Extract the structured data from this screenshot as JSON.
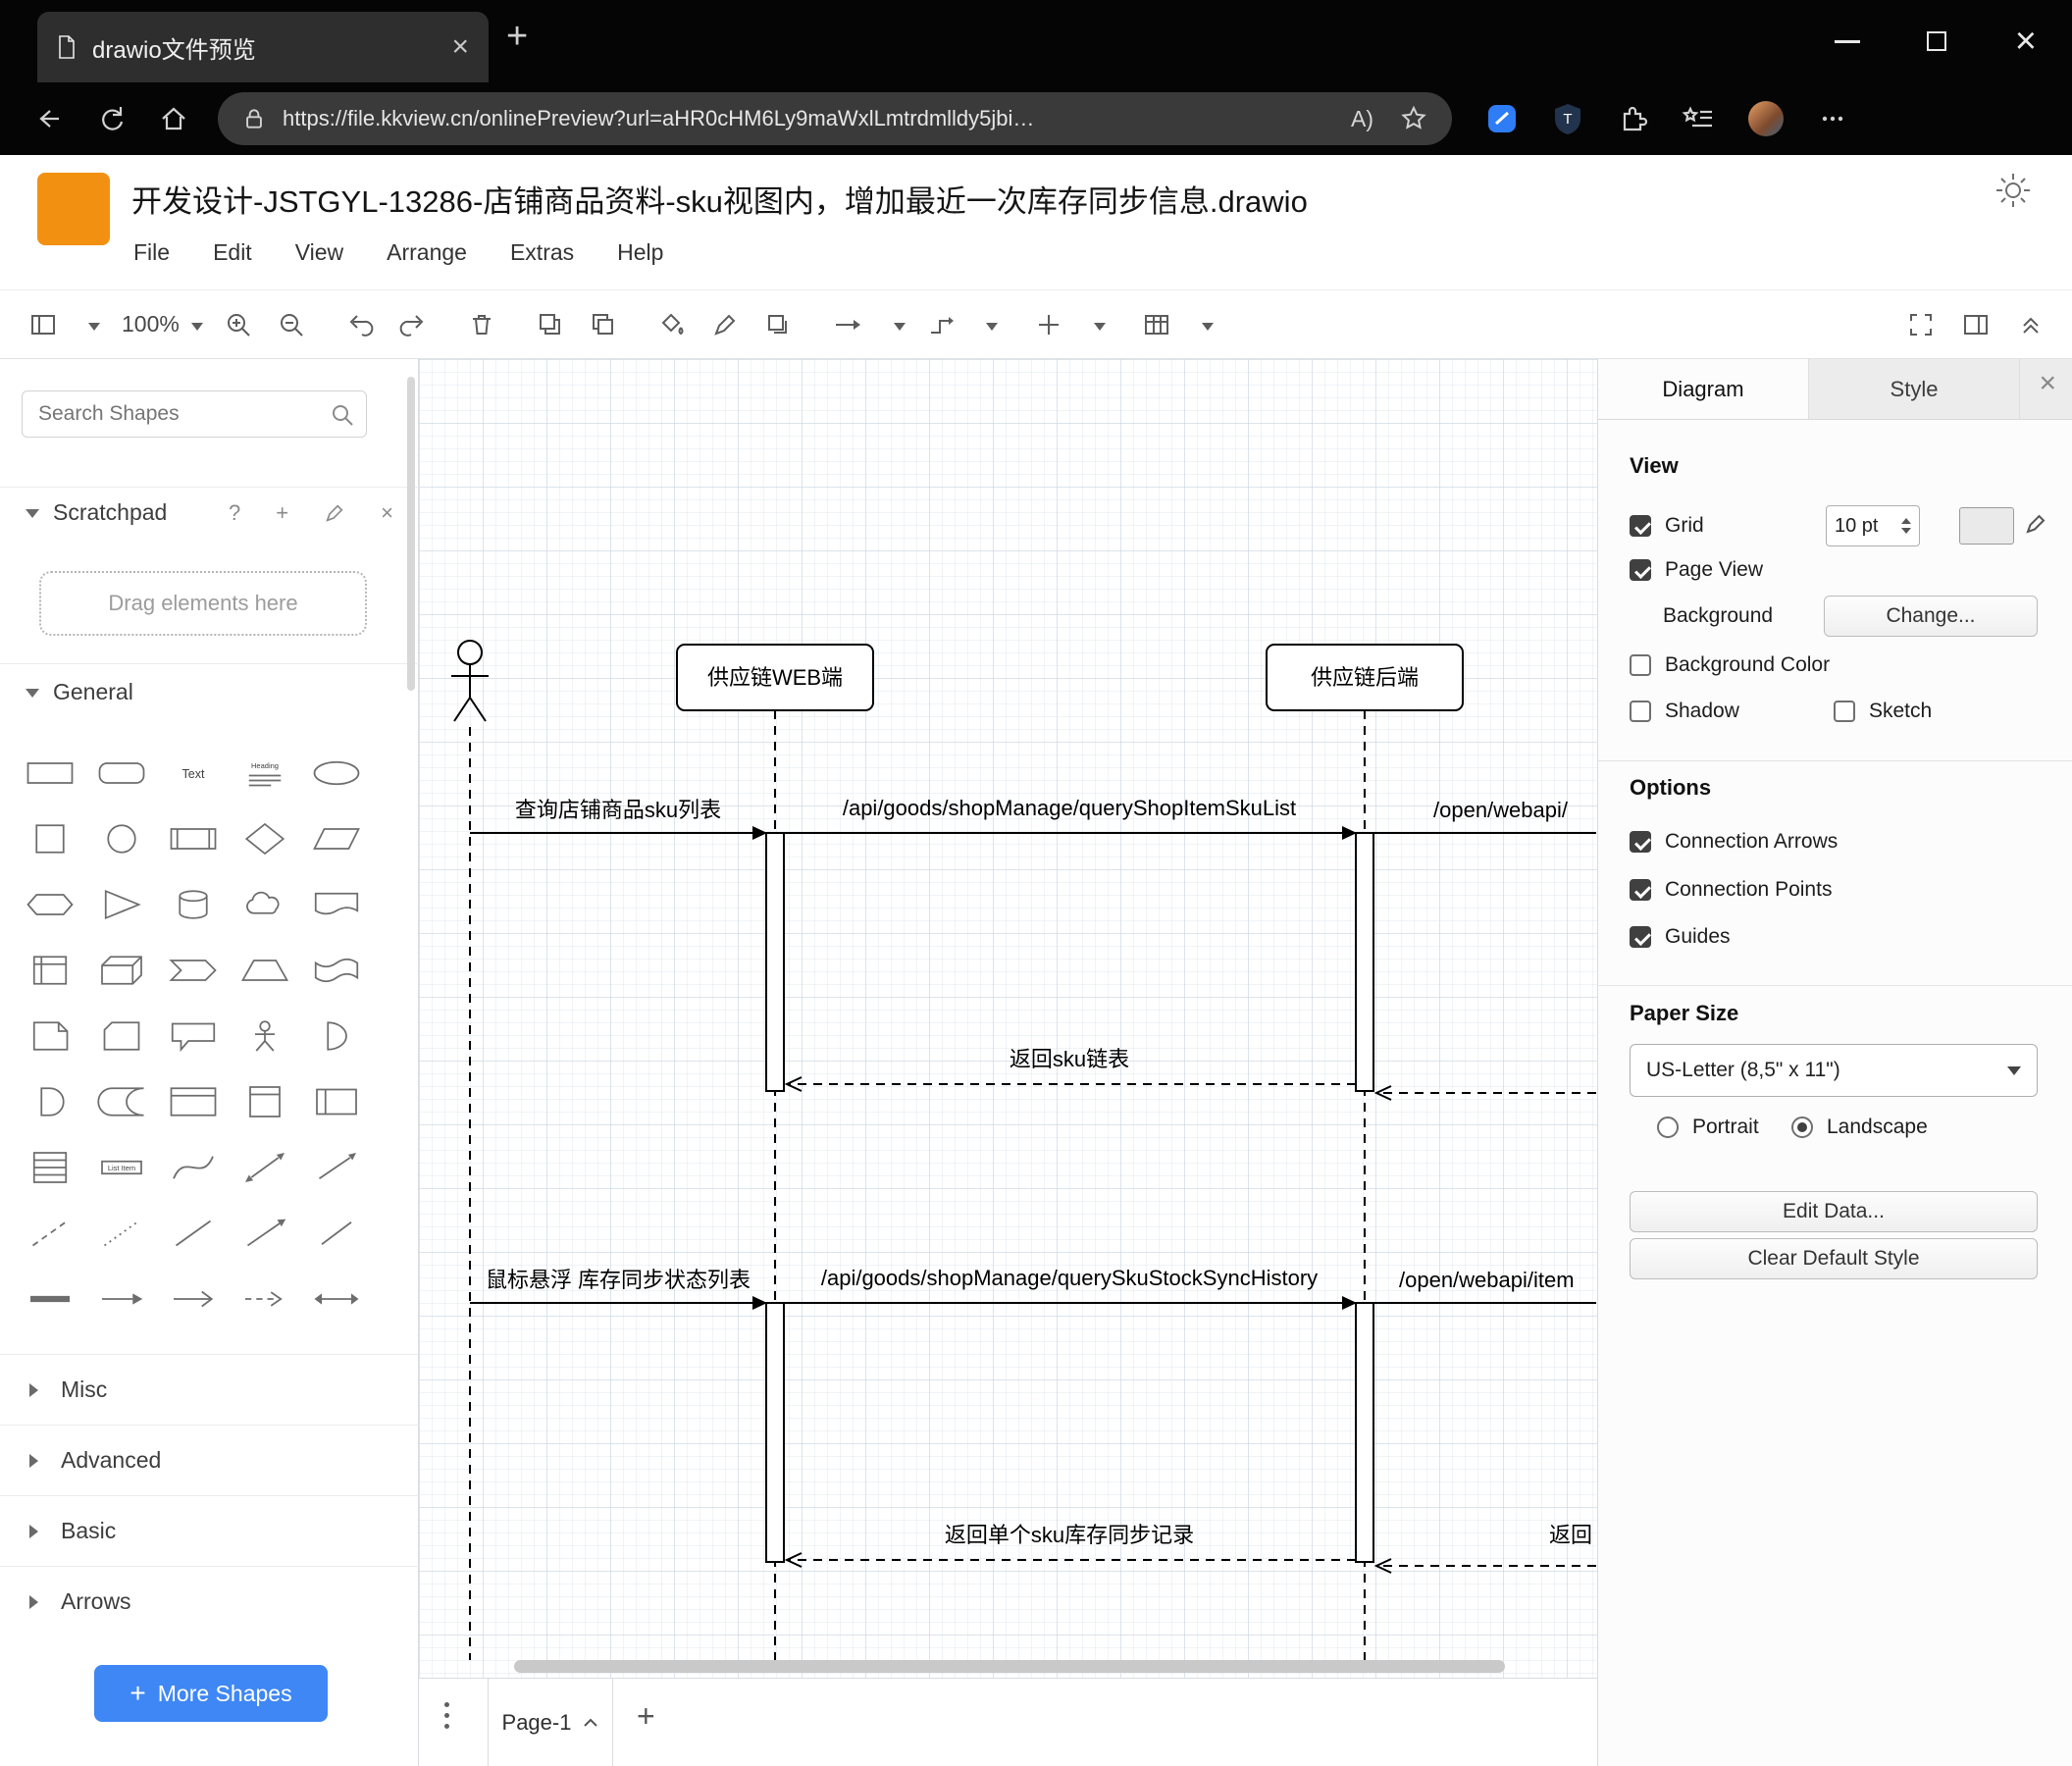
{
  "browser": {
    "tab_title": "drawio文件预览",
    "url": "https://file.kkview.cn/onlinePreview?url=aHR0cHM6Ly9maWxlLmtrdmlldy5jbi…",
    "read_aloud": "A)"
  },
  "app": {
    "title": "开发设计-JSTGYL-13286-店铺商品资料-sku视图内，增加最近一次库存同步信息.drawio",
    "menus": [
      "File",
      "Edit",
      "View",
      "Arrange",
      "Extras",
      "Help"
    ],
    "zoom": "100%"
  },
  "sidebar": {
    "search_placeholder": "Search Shapes",
    "scratchpad": "Scratchpad",
    "drag_hint": "Drag elements here",
    "sections": {
      "general": "General",
      "misc": "Misc",
      "advanced": "Advanced",
      "basic": "Basic",
      "arrows": "Arrows"
    },
    "text_label": "Text",
    "heading_label": "Heading",
    "list_item_label": "List Item",
    "more_shapes": "More Shapes",
    "shapes": [
      "rectangle",
      "rounded-rectangle",
      "text",
      "heading",
      "ellipse",
      "square",
      "circle",
      "process",
      "diamond",
      "parallelogram",
      "hexagon",
      "triangle",
      "cylinder",
      "cloud",
      "document",
      "internal-storage",
      "cube",
      "step",
      "trapezoid",
      "tape",
      "note",
      "card",
      "callout",
      "actor",
      "or",
      "and",
      "data-storage",
      "container",
      "vertical-container",
      "horizontal-container",
      "list",
      "list-item",
      "curve",
      "bidirectional-arrow",
      "arrow",
      "dashed-line",
      "dotted-line",
      "line",
      "directional-arrow",
      "diagonal-line",
      "link",
      "arrow-right",
      "open-arrow",
      "dashed-arrow",
      "bidirectional-horizontal-arrow"
    ]
  },
  "diagram": {
    "lifeline_web": "供应链WEB端",
    "lifeline_backend": "供应链后端",
    "msg_query_sku_list": "查询店铺商品sku列表",
    "msg_api_query_shop_item_sku_list": "/api/goods/shopManage/queryShopItemSkuList",
    "msg_open_webapi": "/open/webapi/",
    "ret_sku_list": "返回sku链表",
    "msg_hover_stock_sync": "鼠标悬浮 库存同步状态列表",
    "msg_api_query_sku_stock_sync_history": "/api/goods/shopManage/querySkuStockSyncHistory",
    "msg_open_webapi_item": "/open/webapi/item",
    "ret_single_sku": "返回单个sku库存同步记录",
    "ret_partial": "返回"
  },
  "pages": {
    "page1": "Page-1"
  },
  "format": {
    "tab_diagram": "Diagram",
    "tab_style": "Style",
    "view": {
      "heading": "View",
      "grid": "Grid",
      "grid_size": "10 pt",
      "page_view": "Page View",
      "background": "Background",
      "change": "Change...",
      "background_color": "Background Color",
      "shadow": "Shadow",
      "sketch": "Sketch"
    },
    "options": {
      "heading": "Options",
      "connection_arrows": "Connection Arrows",
      "connection_points": "Connection Points",
      "guides": "Guides"
    },
    "paper": {
      "heading": "Paper Size",
      "size": "US-Letter (8,5\" x 11\")",
      "portrait": "Portrait",
      "landscape": "Landscape"
    },
    "edit_data": "Edit Data...",
    "clear_default_style": "Clear Default Style"
  },
  "colors": {
    "logo_orange": "#f29111",
    "more_shapes_blue": "#3f87f5",
    "chrome_black": "#050505"
  }
}
